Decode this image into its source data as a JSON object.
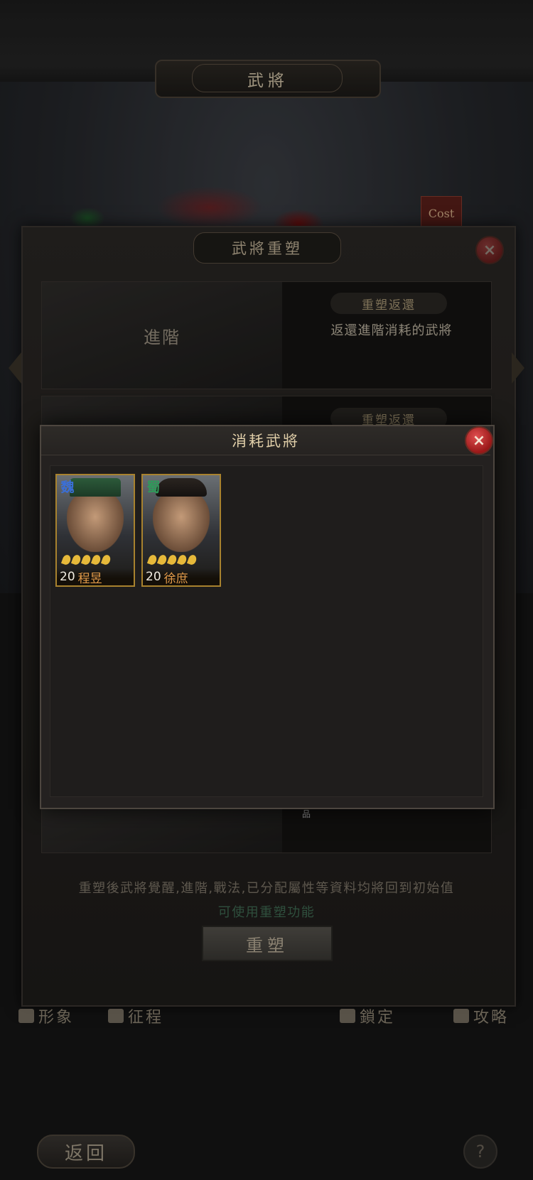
{
  "header": {
    "title": "武將"
  },
  "hero": {
    "cost_label": "Cost"
  },
  "reset_dialog": {
    "title": "武將重塑",
    "rows": [
      {
        "left_label": "進階",
        "pill": "重塑返還",
        "description": "返還進階消耗的武將"
      },
      {
        "left_label": "",
        "pill": "重塑返還",
        "description": ""
      }
    ],
    "notice": "重塑後武將覺醒,進階,戰法,已分配屬性等資料均將回到初始值",
    "notice2": "可使用重塑功能",
    "reset_button": "重塑",
    "stray_label": "品"
  },
  "bottom_nav": {
    "items": [
      {
        "label": "形象"
      },
      {
        "label": "征程"
      },
      {
        "label": "鎖定"
      },
      {
        "label": "攻略"
      }
    ]
  },
  "footer": {
    "back_label": "返回",
    "help_label": "?"
  },
  "consume_dialog": {
    "title": "消耗武將",
    "close_label": "×",
    "cards": [
      {
        "faction": "魏",
        "faction_color": "#3a6fd8",
        "level": "20",
        "name": "程昱",
        "stars": 5
      },
      {
        "faction": "蜀",
        "faction_color": "#2f9a5a",
        "level": "20",
        "name": "徐庶",
        "stars": 5
      }
    ]
  },
  "colors": {
    "accent_gold": "#a8822e",
    "close_red": "#c52a2a",
    "text_main": "#d8cbb0"
  }
}
